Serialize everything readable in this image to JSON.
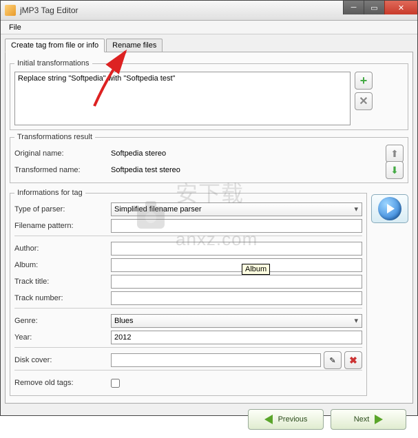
{
  "window": {
    "title": "jMP3 Tag Editor"
  },
  "menu": {
    "file": "File"
  },
  "tabs": {
    "create": "Create tag from file or info",
    "rename": "Rename files"
  },
  "initial": {
    "legend": "Initial transformations",
    "text": "Replace string \"Softpedia\" with \"Softpedia test\""
  },
  "result": {
    "legend": "Transformations result",
    "orig_lbl": "Original name:",
    "orig_val": "Softpedia stereo",
    "trans_lbl": "Transformed name:",
    "trans_val": "Softpedia test stereo"
  },
  "info": {
    "legend": "Informations for tag",
    "parser_lbl": "Type of parser:",
    "parser_val": "Simplified filename parser",
    "pattern_lbl": "Filename pattern:",
    "pattern_val": "",
    "author_lbl": "Author:",
    "author_val": "",
    "album_lbl": "Album:",
    "album_val": "",
    "title_lbl": "Track title:",
    "title_val": "",
    "number_lbl": "Track number:",
    "number_val": "",
    "genre_lbl": "Genre:",
    "genre_val": "Blues",
    "year_lbl": "Year:",
    "year_val": "2012",
    "cover_lbl": "Disk cover:",
    "cover_val": "",
    "remove_lbl": "Remove old tags:"
  },
  "tooltip": "Album",
  "nav": {
    "prev": "Previous",
    "next": "Next"
  },
  "watermark": {
    "cn": "安下载",
    "en": "anxz.com"
  }
}
